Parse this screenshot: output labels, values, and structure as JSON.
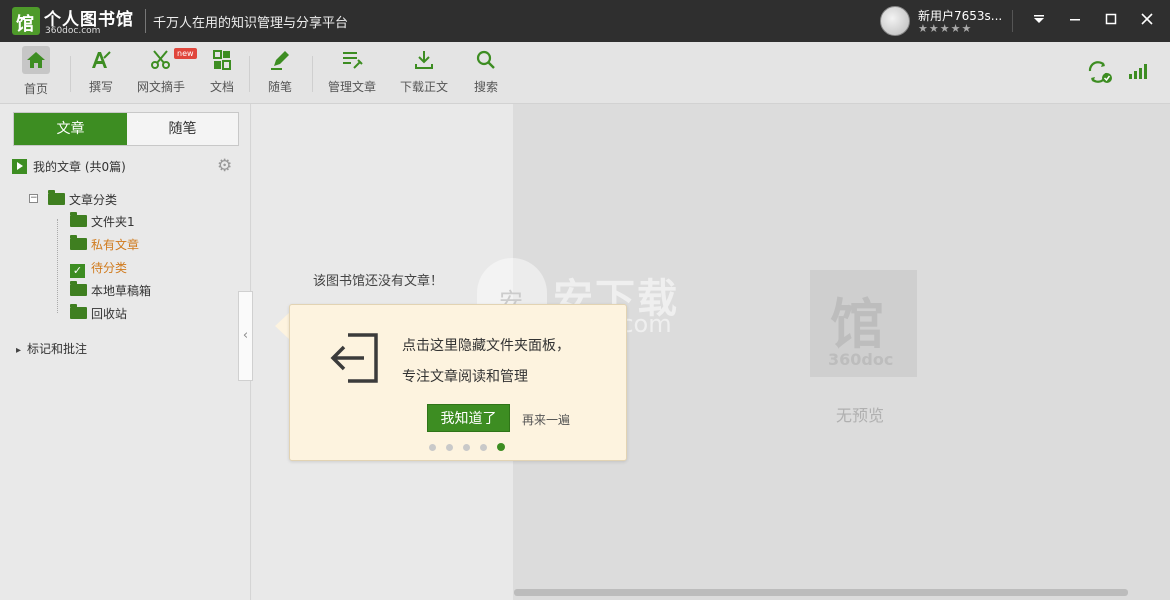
{
  "titlebar": {
    "app_name": "个人图书馆",
    "domain": "360doc.com",
    "slogan": "千万人在用的知识管理与分享平台",
    "username": "新用户7653s...",
    "stars": "★★★★★"
  },
  "toolbar": {
    "items": [
      {
        "label": "首页"
      },
      {
        "label": "撰写"
      },
      {
        "label": "网文摘手"
      },
      {
        "label": "文档"
      },
      {
        "label": "随笔"
      },
      {
        "label": "管理文章"
      },
      {
        "label": "下载正文"
      },
      {
        "label": "搜索"
      }
    ],
    "new_badge": "new"
  },
  "left": {
    "tabs": [
      "文章",
      "随笔"
    ],
    "my_articles": "我的文章 (共0篇)",
    "tree": {
      "root": "文章分类",
      "children": [
        "文件夹1",
        "私有文章",
        "待分类",
        "本地草稿箱",
        "回收站"
      ]
    },
    "marks": "标记和批注"
  },
  "middle": {
    "empty_message": "该图书馆还没有文章！"
  },
  "right": {
    "logo_text": "360doc",
    "no_preview": "无预览"
  },
  "watermark": {
    "text": "安下载",
    "sub": "anxz.com"
  },
  "popup": {
    "line1": "点击这里隐藏文件夹面板，",
    "line2": "专注文章阅读和管理",
    "primary_button": "我知道了",
    "secondary_button": "再来一遍",
    "page_count": 5,
    "active_page": 5
  },
  "colors": {
    "accent": "#3d8d22",
    "titlebar": "#2f2f2f",
    "popup_bg": "#fdf3df",
    "orange": "#d07a1c"
  }
}
